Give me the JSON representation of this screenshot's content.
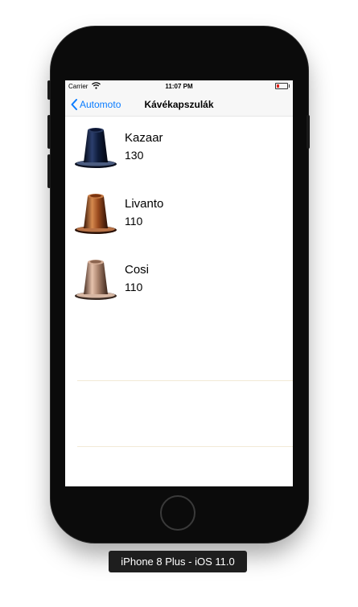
{
  "status_bar": {
    "carrier": "Carrier",
    "time": "11:07 PM",
    "wifi_icon": "wifi-icon",
    "battery_icon": "battery-low-icon",
    "battery_color": "#e0241b"
  },
  "nav_bar": {
    "back_label": "Automoto",
    "back_icon": "chevron-left-icon",
    "title": "Kávékapszulák",
    "accent_color": "#0a7cff"
  },
  "items": [
    {
      "name": "Kazaar",
      "value": "130",
      "capsule_color": "#0f1c3a"
    },
    {
      "name": "Livanto",
      "value": "110",
      "capsule_color": "#9a4a1e"
    },
    {
      "name": "Cosi",
      "value": "110",
      "capsule_color": "#a9826c"
    }
  ],
  "simulator": {
    "device_label": "iPhone 8 Plus - iOS 11.0"
  }
}
